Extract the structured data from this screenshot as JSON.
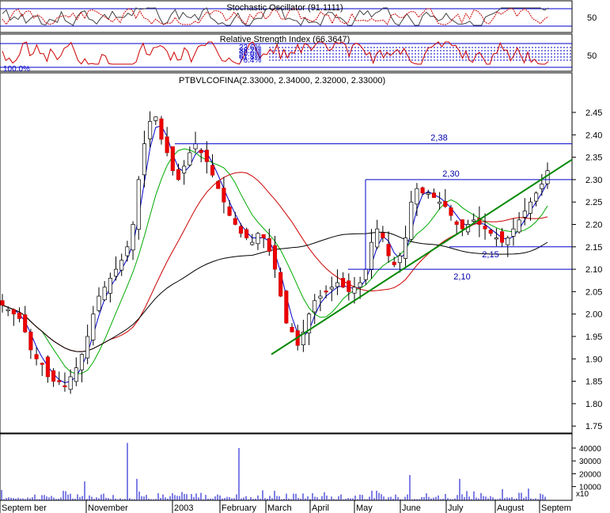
{
  "chart_data": {
    "type": "candlestick",
    "ticker_label": "PTBVLCOFINA(2.33000, 2.34000, 2.32000, 2.33000)",
    "last_ohlc": {
      "open": 2.33,
      "high": 2.34,
      "low": 2.32,
      "close": 2.33
    },
    "price_axis": {
      "ticks": [
        "2.45",
        "2.40",
        "2.35",
        "2.30",
        "2.25",
        "2.20",
        "2.15",
        "2.10",
        "2.05",
        "2.00",
        "1.95",
        "1.90",
        "1.85",
        "1.80",
        "1.75"
      ],
      "range": [
        1.72,
        2.5
      ]
    },
    "volume_axis": {
      "ticks": [
        "40000",
        "30000",
        "20000",
        "10000"
      ],
      "multiplier": "x10",
      "range": [
        0,
        46000
      ]
    },
    "x_axis": {
      "labels": [
        "Septem ber",
        "November",
        "2003",
        "February",
        "March",
        "April",
        "May",
        "June",
        "July",
        "August",
        "Septem"
      ]
    },
    "stochastic": {
      "title": "Stochastic Oscillator (91.1111)",
      "tick": "50"
    },
    "rsi": {
      "title": "Relative Strength Index (66.3647)",
      "tick": "50",
      "fib_levels": [
        "23.6%",
        "38.2%",
        "50.0%",
        "61.8%",
        "76.4%",
        "100.0%"
      ]
    },
    "horizontal_levels": [
      {
        "label": "2,38",
        "value": 2.38
      },
      {
        "label": "2,30",
        "value": 2.3
      },
      {
        "label": "2,15",
        "value": 2.15
      },
      {
        "label": "2,10",
        "value": 2.1
      }
    ],
    "trendline": {
      "from": {
        "x": "early March 2003",
        "y": 1.91
      },
      "to": {
        "x": "September 2003",
        "y": 2.32
      }
    },
    "series": [
      {
        "kind": "close",
        "values": [
          2.02,
          2.01,
          2.0,
          1.99,
          1.96,
          1.92,
          1.9,
          1.89,
          1.86,
          1.85,
          1.85,
          1.84,
          1.86,
          1.88,
          1.91,
          1.95,
          2.0,
          2.04,
          2.06,
          2.08,
          2.1,
          2.12,
          2.15,
          2.2,
          2.3,
          2.38,
          2.43,
          2.44,
          2.39,
          2.36,
          2.32,
          2.3,
          2.33,
          2.36,
          2.38,
          2.36,
          2.34,
          2.31,
          2.28,
          2.25,
          2.22,
          2.2,
          2.18,
          2.17,
          2.16,
          2.18,
          2.17,
          2.14,
          2.1,
          2.04,
          1.98,
          1.96,
          1.93,
          1.96,
          2.0,
          2.03,
          2.04,
          2.05,
          2.06,
          2.07,
          2.06,
          2.05,
          2.06,
          2.07,
          2.1,
          2.16,
          2.19,
          2.17,
          2.13,
          2.11,
          2.13,
          2.17,
          2.25,
          2.28,
          2.27,
          2.27,
          2.26,
          2.25,
          2.24,
          2.22,
          2.2,
          2.19,
          2.2,
          2.21,
          2.2,
          2.19,
          2.18,
          2.17,
          2.16,
          2.17,
          2.19,
          2.21,
          2.23,
          2.25,
          2.27,
          2.29,
          2.32
        ]
      },
      {
        "kind": "moving-average",
        "period": "short",
        "color": "#0000cc"
      },
      {
        "kind": "moving-average",
        "period": "medium",
        "color": "#00aa00"
      },
      {
        "kind": "moving-average",
        "period": "long",
        "color": "#cc0000"
      },
      {
        "kind": "moving-average",
        "period": "very long",
        "color": "#000000"
      }
    ]
  }
}
